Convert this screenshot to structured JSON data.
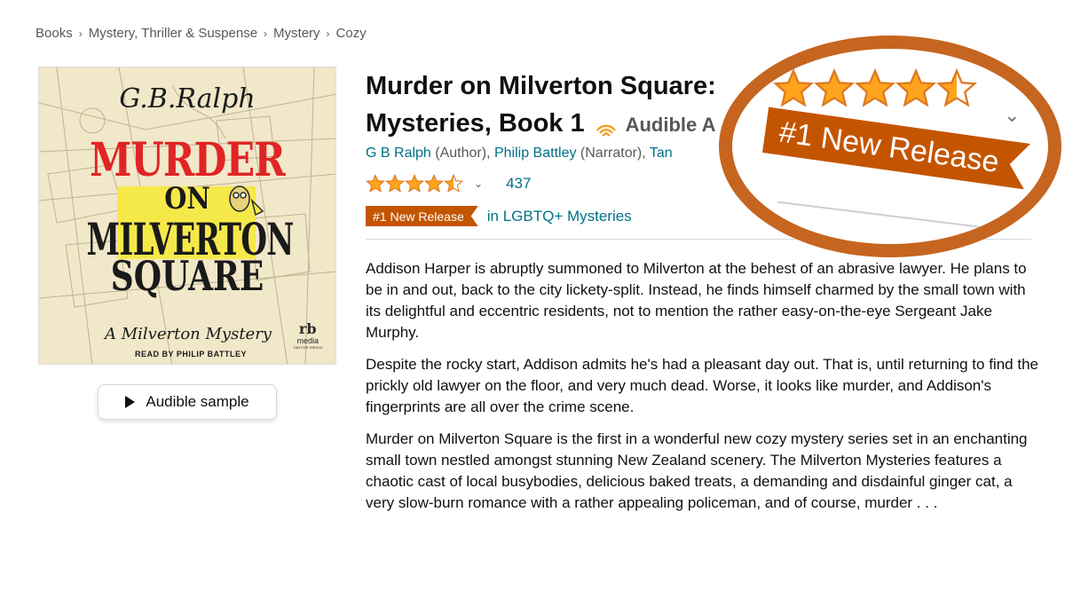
{
  "breadcrumb": [
    {
      "label": "Books"
    },
    {
      "label": "Mystery, Thriller & Suspense"
    },
    {
      "label": "Mystery"
    },
    {
      "label": "Cozy"
    }
  ],
  "cover": {
    "author": "G.B.Ralph",
    "title_line1": "MURDER",
    "title_line2": "ON",
    "title_line3": "MILVERTON",
    "title_line4": "SQUARE",
    "series": "A Milverton Mystery",
    "read_by": "READ BY PHILIP BATTLEY",
    "publisher_logo": "rb",
    "publisher_text": "media",
    "publisher_sub": "TANTOR MEDIA"
  },
  "sample_button": {
    "label": "Audible sample",
    "icon": "play-icon"
  },
  "product": {
    "title_line1": "Murder on Milverton Square:",
    "title_line2": "Mysteries, Book 1",
    "format": "Audible A",
    "contributors": [
      {
        "name": "G B Ralph",
        "role": "(Author),"
      },
      {
        "name": "Philip Battley",
        "role": "(Narrator),"
      },
      {
        "name": "Tan",
        "role": ""
      }
    ]
  },
  "rating": {
    "stars_value": 4.5,
    "stars_max": 5,
    "count": "437"
  },
  "badge": {
    "label": "#1 New Release",
    "category": "in LGBTQ+ Mysteries"
  },
  "zoom_callout": {
    "badge_label": "#1 New Release",
    "stars_value": 4.5
  },
  "description": {
    "paragraphs": [
      "Addison Harper is abruptly summoned to Milverton at the behest of an abrasive lawyer. He plans to be in and out, back to the city lickety-split. Instead, he finds himself charmed by the small town with its delightful and eccentric residents, not to mention the rather easy-on-the-eye Sergeant Jake Murphy.",
      "Despite the rocky start, Addison admits he's had a pleasant day out. That is, until returning to find the prickly old lawyer on the floor, and very much dead. Worse, it looks like murder, and Addison's fingerprints are all over the crime scene.",
      "Murder on Milverton Square is the first in a wonderful new cozy mystery series set in an enchanting small town nestled amongst stunning New Zealand scenery. The Milverton Mysteries features a chaotic cast of local busybodies, delicious baked treats, a demanding and disdainful ginger cat, a very slow-burn romance with a rather appealing policeman, and of course, murder . . ."
    ]
  },
  "colors": {
    "link": "#007185",
    "badge": "#c45500",
    "star": "#ffa41c",
    "callout_ring": "#c5651f",
    "cover_red": "#e02525",
    "cover_yellow": "#f5e94a"
  }
}
